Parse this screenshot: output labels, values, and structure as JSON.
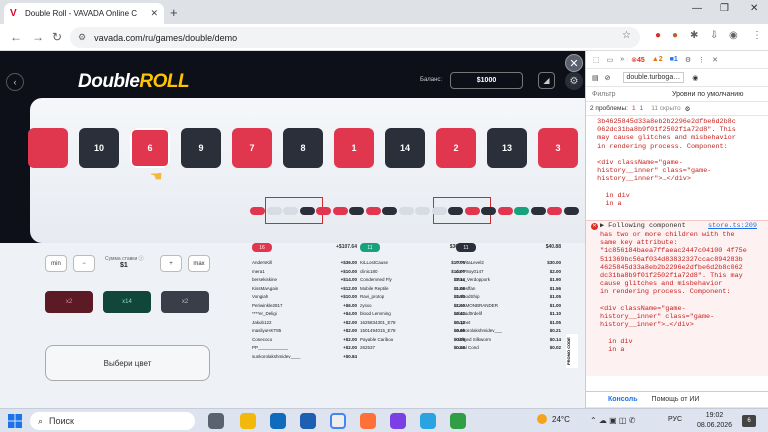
{
  "browser": {
    "tab_title": "Double Roll - VAVADA Online C",
    "url": "vavada.com/ru/games/double/demo"
  },
  "game": {
    "logo_part1": "Double",
    "logo_part2": "ROLL",
    "balance_label": "Баланс:",
    "balance": "$1000",
    "strip": [
      {
        "n": "",
        "c": "red"
      },
      {
        "n": "10",
        "c": "black"
      },
      {
        "n": "6",
        "c": "red"
      },
      {
        "n": "9",
        "c": "black"
      },
      {
        "n": "7",
        "c": "red"
      },
      {
        "n": "8",
        "c": "black"
      },
      {
        "n": "1",
        "c": "red"
      },
      {
        "n": "14",
        "c": "black"
      },
      {
        "n": "2",
        "c": "red"
      },
      {
        "n": "13",
        "c": "black"
      },
      {
        "n": "3",
        "c": "red"
      },
      {
        "n": "",
        "c": "black"
      }
    ],
    "history": [
      "red",
      "white",
      "white",
      "black",
      "red",
      "red",
      "black",
      "red",
      "black",
      "white",
      "white",
      "white",
      "black",
      "red",
      "black",
      "red",
      "green",
      "black",
      "red",
      "black"
    ],
    "min_label": "min",
    "minus_label": "−",
    "plus_label": "+",
    "max_label": "max",
    "amount_label": "Сумма ставки ⓘ",
    "amount": "$1",
    "bet_red": "x2",
    "bet_green": "x14",
    "bet_black": "x2",
    "choose_color": "Выбери цвет",
    "promo_text": "PROMO CODE",
    "columns": [
      {
        "count": "16",
        "total": "+$107.64",
        "color": "#e0364e",
        "rows": [
          [
            "AndersKill",
            "+$36.00"
          ],
          [
            "mera1",
            "+$10.00"
          ],
          [
            "bersekiskine",
            "+$14.00"
          ],
          [
            "KissMaAgain",
            "+$12.00"
          ],
          [
            "Vongiah",
            "+$10.00"
          ],
          [
            "Periwinkle2817",
            "+$6.00"
          ],
          [
            "****er_Deligi",
            "+$4.00"
          ],
          [
            "Jakub122",
            "+$2.00"
          ],
          [
            "masliyuHKT85",
            "+$2.00"
          ],
          [
            "Conecoco",
            "+$2.00"
          ],
          [
            "PP____________",
            "+$2.00"
          ],
          [
            "sunkorolakshmidev____",
            "+$0.84"
          ]
        ]
      },
      {
        "count": "11",
        "total": "$36.03",
        "color": "#16a37b",
        "rows": [
          [
            "KiLLostCause",
            "$10.00"
          ],
          [
            "clinic180",
            "$10.00"
          ],
          [
            "Condemned Fly",
            "$3.14"
          ],
          [
            "Mobile Reptile",
            "$1.05"
          ],
          [
            "Ravi_protop",
            "$1.00"
          ],
          [
            "zysxo",
            "$1.00"
          ],
          [
            "blood Lemming",
            "$0.42"
          ],
          [
            "1625834301_E78",
            "$0.12"
          ],
          [
            "1501494015_E78",
            "$0.09"
          ],
          [
            "Payable Caribou",
            "$0.09"
          ],
          [
            "262537",
            "$0.06"
          ]
        ]
      },
      {
        "count": "11",
        "total": "$40.88",
        "color": "#2b2f3a",
        "rows": [
          [
            "****VitaLevel2",
            "$30.00"
          ],
          [
            "da***8oy0147",
            "$2.00"
          ],
          [
            "Mos_Verdoppork",
            "$1.90"
          ],
          [
            "Lovesffan",
            "$1.56"
          ],
          [
            "UnfoodShip",
            "$1.05"
          ],
          [
            "CHAMONBRANDER",
            "$1.00"
          ],
          [
            "ahmad0rdelif",
            "$1.10"
          ],
          [
            "Sopnet",
            "$1.05"
          ],
          [
            "sunkorolakshmidev___",
            "$0.21"
          ],
          [
            "Obliged Silkworm",
            "$0.14"
          ],
          [
            "Local Cond",
            "$0.02"
          ]
        ]
      }
    ]
  },
  "devtools": {
    "context": "double.turboga…",
    "errors": "45",
    "warnings": "2",
    "info": "1",
    "filter_label": "Фильтр",
    "levels": "Уровни по умолчанию",
    "issues": "2 проблемы:",
    "issues_err": "1",
    "issues_info": "1",
    "hidden": "11 скрыто",
    "log1": "  3b4625845d33a8eb2b2296e2dfbe6d2b8c\n  062dc31ba8b9f01f2502f1a72d8\". This\n  may cause glitches and misbehavior\n  in rendering process. Component:\n\n  <div className=\"game-\n  history__inner\" class=\"game-\n  history__inner\">…</div>\n\n    in div\n    in a",
    "log2_head": "▶ Following component",
    "log2_link": "store.ts:209",
    "log2": "has two or more children with the\nsame key attribute:\n\"1c856184baea7ffaeac2447c04100 4f75e\n511369bc56af034d83832327ccac894283b\n4625845d33a8eb2b2296e2dfbe6d2b8c062\ndc31ba8b9f01f2502f1a72d8\". This may\ncause glitches and misbehavior\nin rendering process. Component:\n\n<div className=\"game-\nhistory__inner\" class=\"game-\nhistory__inner\">…</div>\n\n  in div\n  in a",
    "tab_console": "Консоль",
    "tab_help": "Помощь от ИИ"
  },
  "taskbar": {
    "search": "Поиск",
    "temp": "24°C",
    "lang": "РУС",
    "time": "19:02",
    "date": "08.06.2026",
    "notif": "6"
  }
}
